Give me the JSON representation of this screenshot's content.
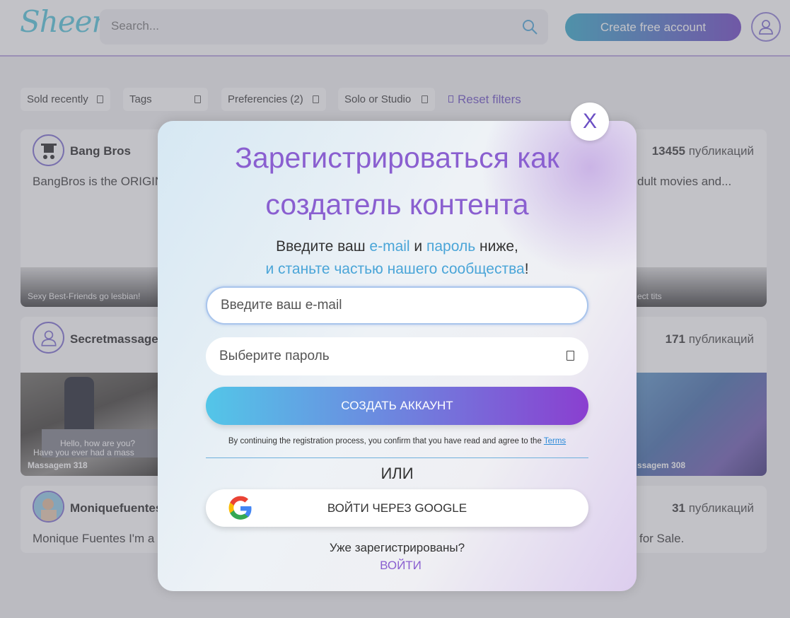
{
  "header": {
    "logo": "Sheer",
    "search_placeholder": "Search...",
    "create_label": "Create free account"
  },
  "filters": {
    "sold_recently": "Sold recently",
    "tags": "Tags",
    "preferencies": "Preferencies (2)",
    "solo_studio": "Solo or Studio",
    "reset": "Reset filters"
  },
  "cards": [
    {
      "name": "Bang Bros",
      "count": "13455",
      "count_suffix": "публикаций",
      "desc": "BangBros is the ORIGIN",
      "desc_right": "dult movies and...",
      "strip_left": "Sexy Best-Friends go lesbian!",
      "strip_right": "ect tits"
    },
    {
      "name": "Secretmassage",
      "count": "171",
      "count_suffix": "публикаций",
      "thumb_left": "Massagem 318",
      "thumb_right": "ssagem 308",
      "subtitle_1": "Hello, how are you?",
      "subtitle_2": "Have you ever had a mass"
    },
    {
      "name": "Moniquefuentes",
      "count": "31",
      "count_suffix": "публикаций",
      "desc": "Monique Fuentes I'm a",
      "desc_right": "for Sale."
    }
  ],
  "modal": {
    "close": "X",
    "title_line1": "Зарегистрироваться как",
    "title_line2": "создатель контента",
    "sub_a": "Введите ваш ",
    "sub_email": "e-mail",
    "sub_and": " и ",
    "sub_password": "пароль",
    "sub_below": " ниже,",
    "sub_join": "и станьте частью нашего сообщества",
    "sub_excl": "!",
    "email_placeholder": "Введите ваш e-mail",
    "password_placeholder": "Выберите пароль",
    "submit": "СОЗДАТЬ АККАУНТ",
    "terms_text": "By continuing the registration process, you confirm that you have read and agree to the ",
    "terms_link": "Terms",
    "or": "ИЛИ",
    "google": "ВОЙТИ ЧЕРЕЗ GOOGLE",
    "already": "Уже зарегистрированы?",
    "login": "ВОЙТИ"
  }
}
